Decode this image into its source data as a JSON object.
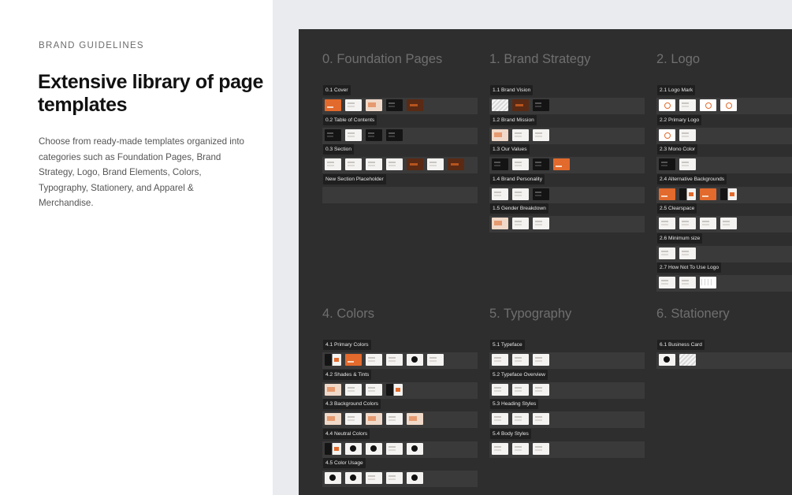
{
  "intro": {
    "eyebrow": "BRAND GUIDELINES",
    "headline": "Extensive library of page templates",
    "description": "Choose from ready-made templates organized into categories such as Foundation Pages, Brand Strategy, Logo, Brand Elements, Colors, Typography, Stationery, and Apparel & Merchandise."
  },
  "groups": [
    {
      "title": "0. Foundation Pages",
      "sections": [
        {
          "label": "0.1 Cover",
          "thumbs": [
            "orange",
            "white",
            "peach",
            "dark",
            "brown"
          ]
        },
        {
          "label": "0.2 Table of Contents",
          "thumbs": [
            "dark",
            "white",
            "dark",
            "dark"
          ]
        },
        {
          "label": "0.3 Section",
          "thumbs": [
            "white",
            "white",
            "white",
            "white",
            "brown",
            "white",
            "brown"
          ]
        },
        {
          "label": "New Section Placeholder",
          "thumbs": []
        }
      ]
    },
    {
      "title": "1. Brand Strategy",
      "sections": [
        {
          "label": "1.1 Brand Vision",
          "thumbs": [
            "pattern",
            "brown",
            "dark"
          ]
        },
        {
          "label": "1.2 Brand Mission",
          "thumbs": [
            "peach",
            "white",
            "white"
          ]
        },
        {
          "label": "1.3 Our Values",
          "thumbs": [
            "dark",
            "white",
            "dark",
            "orange"
          ]
        },
        {
          "label": "1.4 Brand Personality",
          "thumbs": [
            "white",
            "white",
            "dark"
          ]
        },
        {
          "label": "1.5 Gender Breakdown",
          "thumbs": [
            "peach",
            "white",
            "white"
          ]
        }
      ]
    },
    {
      "title": "2. Logo",
      "sections": [
        {
          "label": "2.1 Logo Mark",
          "thumbs": [
            "logo",
            "white",
            "logo",
            "logo"
          ]
        },
        {
          "label": "2.2 Primary Logo",
          "thumbs": [
            "logo",
            "white"
          ]
        },
        {
          "label": "2.3 Mono Color",
          "thumbs": [
            "dark",
            "white"
          ]
        },
        {
          "label": "2.4 Alternative Backgrounds",
          "thumbs": [
            "orange",
            "mixed",
            "orange",
            "mixed"
          ]
        },
        {
          "label": "2.5 Clearspace",
          "thumbs": [
            "white",
            "white",
            "white",
            "white"
          ]
        },
        {
          "label": "2.6 Minimum size",
          "thumbs": [
            "white",
            "white"
          ]
        },
        {
          "label": "2.7 How Not To Use Logo",
          "thumbs": [
            "white",
            "white",
            "grid"
          ]
        }
      ]
    },
    {
      "title": "4. Colors",
      "sections": [
        {
          "label": "4.1 Primary Colors",
          "thumbs": [
            "mixed",
            "orange",
            "white",
            "white",
            "circle",
            "white"
          ]
        },
        {
          "label": "4.2 Shades & Tints",
          "thumbs": [
            "peach",
            "white",
            "white",
            "mixed"
          ]
        },
        {
          "label": "4.3 Background Colors",
          "thumbs": [
            "peach",
            "white",
            "peach",
            "white",
            "peach"
          ]
        },
        {
          "label": "4.4 Neutral Colors",
          "thumbs": [
            "mixed",
            "circle",
            "circle",
            "white",
            "circle"
          ]
        },
        {
          "label": "4.5 Color Usage",
          "thumbs": [
            "circle",
            "circle",
            "white",
            "white",
            "circle"
          ]
        }
      ]
    },
    {
      "title": "5. Typography",
      "sections": [
        {
          "label": "5.1 Typeface",
          "thumbs": [
            "white",
            "white",
            "white"
          ]
        },
        {
          "label": "5.2 Typeface Overview",
          "thumbs": [
            "white",
            "white",
            "white"
          ]
        },
        {
          "label": "5.3 Heading Styles",
          "thumbs": [
            "white",
            "white",
            "white"
          ]
        },
        {
          "label": "5.4 Body Styles",
          "thumbs": [
            "white",
            "white",
            "white"
          ]
        }
      ]
    },
    {
      "title": "6. Stationery",
      "sections": [
        {
          "label": "6.1 Business Card",
          "thumbs": [
            "circle",
            "pattern"
          ]
        }
      ]
    }
  ]
}
